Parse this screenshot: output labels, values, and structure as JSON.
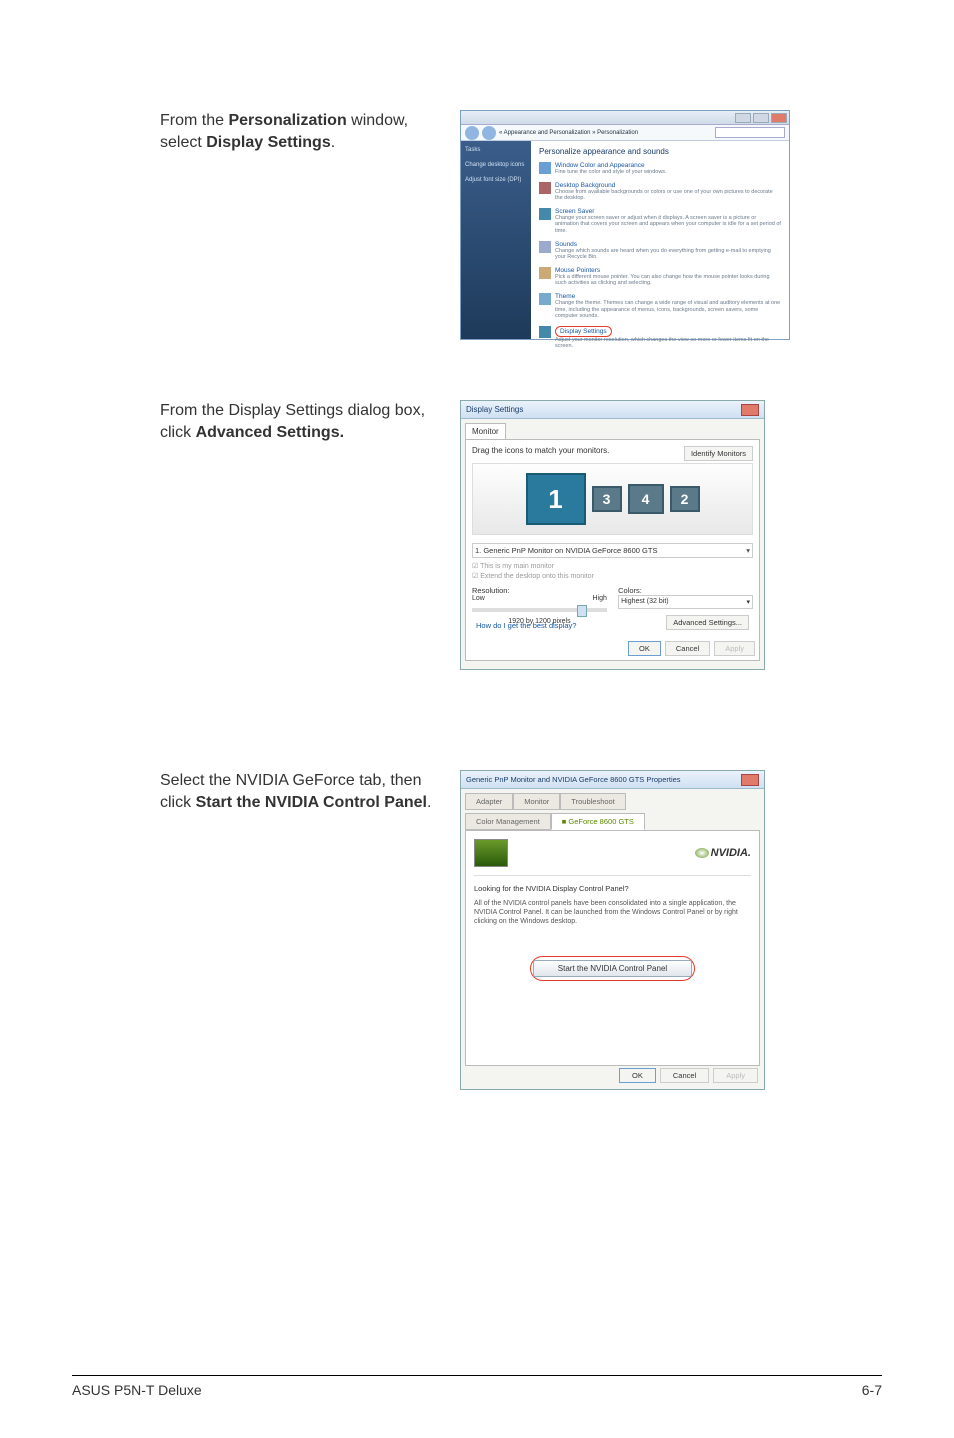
{
  "instruction1": {
    "prefix": "From the ",
    "bold": "Personalization",
    "mid": " window, select ",
    "bold2": "Display Settings",
    "suffix": "."
  },
  "instruction2": {
    "prefix": "From the Display Settings dialog box, click ",
    "bold": "Advanced Settings."
  },
  "instruction3": {
    "prefix": "Select the NVIDIA GeForce tab, then click ",
    "bold": "Start the NVIDIA Control Panel",
    "suffix": "."
  },
  "pers": {
    "crumb": "« Appearance and Personalization » Personalization",
    "side": {
      "tasks": "Tasks",
      "item1": "Change desktop icons",
      "item2": "Adjust font size (DPI)"
    },
    "title": "Personalize appearance and sounds",
    "items": [
      {
        "link": "Window Color and Appearance",
        "desc": "Fine tune the color and style of your windows."
      },
      {
        "link": "Desktop Background",
        "desc": "Choose from available backgrounds or colors or use one of your own pictures to decorate the desktop."
      },
      {
        "link": "Screen Saver",
        "desc": "Change your screen saver or adjust when it displays. A screen saver is a picture or animation that covers your screen and appears when your computer is idle for a set period of time."
      },
      {
        "link": "Sounds",
        "desc": "Change which sounds are heard when you do everything from getting e-mail to emptying your Recycle Bin."
      },
      {
        "link": "Mouse Pointers",
        "desc": "Pick a different mouse pointer. You can also change how the mouse pointer looks during such activities as clicking and selecting."
      },
      {
        "link": "Theme",
        "desc": "Change the theme. Themes can change a wide range of visual and auditory elements at one time, including the appearance of menus, icons, backgrounds, screen savers, some computer sounds."
      },
      {
        "link": "Display Settings",
        "desc": "Adjust your monitor resolution, which changes the view so more or fewer items fit on the screen."
      }
    ]
  },
  "ds": {
    "title": "Display Settings",
    "tab": "Monitor",
    "drag": "Drag the icons to match your monitors.",
    "identify": "Identify Monitors",
    "mon1": "1",
    "mon3": "3",
    "mon4": "4",
    "mon2": "2",
    "select": "1. Generic PnP Monitor on NVIDIA GeForce 8600 GTS",
    "chk1": "This is my main monitor",
    "chk2": "Extend the desktop onto this monitor",
    "res": "Resolution:",
    "low": "Low",
    "high": "High",
    "px": "1920 by 1200 pixels",
    "colors": "Colors:",
    "colval": "Highest (32 bit)",
    "link": "How do I get the best display?",
    "adv": "Advanced Settings...",
    "ok": "OK",
    "cancel": "Cancel",
    "apply": "Apply"
  },
  "gf": {
    "title": "Generic PnP Monitor and NVIDIA GeForce 8600 GTS Properties",
    "tabs": {
      "adapter": "Adapter",
      "monitor": "Monitor",
      "trouble": "Troubleshoot",
      "color": "Color Management",
      "nv": "GeForce 8600 GTS"
    },
    "nvlogo": "NVIDIA.",
    "q": "Looking for the NVIDIA Display Control Panel?",
    "desc": "All of the NVIDIA control panels have been consolidated into a single application, the NVIDIA Control Panel. It can be launched from the Windows Control Panel or by right clicking on the Windows desktop.",
    "start": "Start the NVIDIA Control Panel",
    "ok": "OK",
    "cancel": "Cancel",
    "apply": "Apply"
  },
  "footer": {
    "left": "ASUS P5N-T Deluxe",
    "right": "6-7"
  }
}
